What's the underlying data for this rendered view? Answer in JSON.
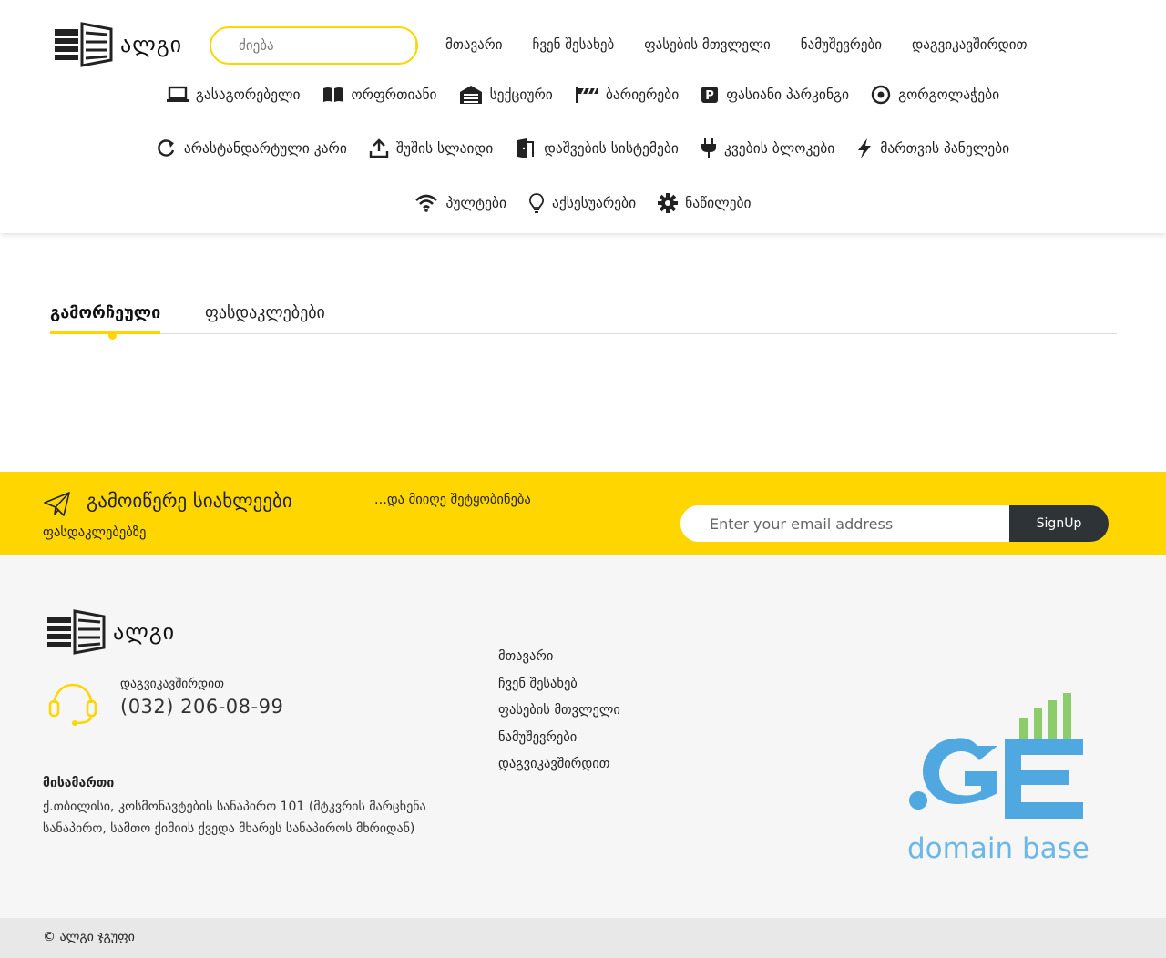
{
  "brand": {
    "name": "ალგი"
  },
  "search": {
    "placeholder": "ძიება",
    "icon": "search-icon"
  },
  "topnav": [
    "მთავარი",
    "ჩვენ შესახებ",
    "ფასების მთვლელი",
    "ნამუშევრები",
    "დაგვიკავშირდით"
  ],
  "categories_row1": [
    {
      "label": "გასაგორებელი",
      "icon": "laptop-icon"
    },
    {
      "label": "ორფრთიანი",
      "icon": "book-open-icon"
    },
    {
      "label": "სექციური",
      "icon": "garage-door-icon"
    },
    {
      "label": "ბარიერები",
      "icon": "barrier-icon"
    },
    {
      "label": "ფასიანი პარკინგი",
      "icon": "parking-icon"
    },
    {
      "label": "გორგოლაჭები",
      "icon": "roller-icon"
    }
  ],
  "categories_row2": [
    {
      "label": "არასტანდარტული კარი",
      "icon": "rotate-icon"
    },
    {
      "label": "შუშის სლაიდი",
      "icon": "upload-icon"
    },
    {
      "label": "დაშვების სისტემები",
      "icon": "door-open-icon"
    },
    {
      "label": "კვების ბლოკები",
      "icon": "plug-icon"
    },
    {
      "label": "მართვის პანელები",
      "icon": "lightning-icon"
    }
  ],
  "categories_row3": [
    {
      "label": "პულტები",
      "icon": "wifi-icon"
    },
    {
      "label": "აქსესუარები",
      "icon": "lightbulb-icon"
    },
    {
      "label": "ნაწილები",
      "icon": "gear-icon"
    }
  ],
  "tabs": {
    "active": "გამორჩეული",
    "second": "ფასდაკლებები"
  },
  "newsletter": {
    "title": "გამოიწერე სიახლეები",
    "sub1": "...და მიიღე შეტყობინება",
    "sub2": "ფასდაკლებებზე",
    "email_placeholder": "Enter your email address",
    "button": "SignUp",
    "icon": "paper-plane-icon"
  },
  "footer": {
    "contact_label": "დაგვიკავშირდით",
    "phone": "(032) 206-08-99",
    "address_label": "მისამართი",
    "address": "ქ.თბილისი, კოსმონავტების სანაპირო 101 (მტკვრის მარცხენა სანაპირო, სამთო ქიმიის ქვედა მხარეს სანაპიროს მხრიდან)",
    "links": [
      "მთავარი",
      "ჩვენ შესახებ",
      "ფასების მთვლელი",
      "ნამუშევრები",
      "დაგვიკავშირდით"
    ],
    "partner_logo_text": ".GE",
    "partner_sub": "domain base"
  },
  "copyright": "© ალგი ჯგუფი",
  "colors": {
    "accent": "#ffd600",
    "dark": "#2e3338",
    "ge_blue": "#4fa8e0",
    "ge_green": "#8ccc6a"
  }
}
